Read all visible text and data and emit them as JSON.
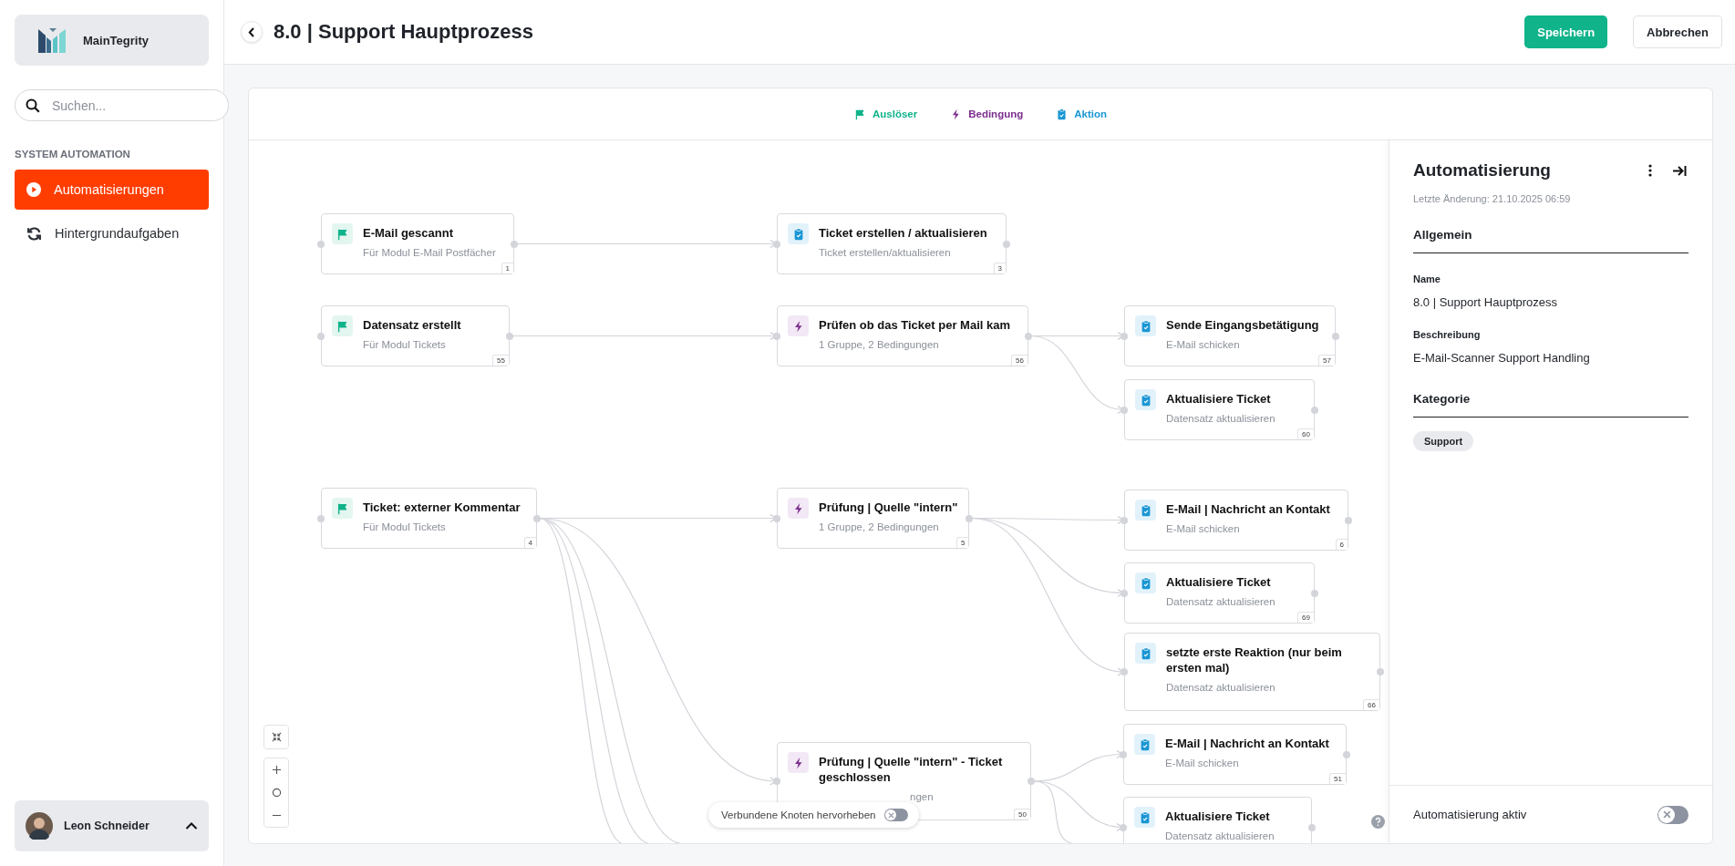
{
  "app": {
    "name": "MainTegrity"
  },
  "search": {
    "placeholder": "Suchen..."
  },
  "sidebar": {
    "section": "SYSTEM AUTOMATION",
    "items": [
      {
        "label": "Automatisierungen",
        "selected": true
      },
      {
        "label": "Hintergrundaufgaben",
        "selected": false
      }
    ]
  },
  "user": {
    "name": "Leon Schneider"
  },
  "header": {
    "title": "8.0 | Support Hauptprozess",
    "buttons": [
      {
        "label": "Speichern",
        "kind": "primary"
      },
      {
        "label": "Abbrechen",
        "kind": "secondary"
      }
    ]
  },
  "legend": [
    {
      "label": "Auslöser",
      "kind": "trigger"
    },
    {
      "label": "Bedingung",
      "kind": "condition"
    },
    {
      "label": "Aktion",
      "kind": "action"
    }
  ],
  "nodes": [
    {
      "kind": "trigger",
      "title": "E-Mail gescannt",
      "subtitle": "Für Modul E-Mail Postfächer",
      "number": "1"
    },
    {
      "kind": "action",
      "title": "Ticket erstellen / aktualisieren",
      "subtitle": "Ticket erstellen/aktualisieren",
      "number": "3"
    },
    {
      "kind": "trigger",
      "title": "Datensatz erstellt",
      "subtitle": "Für Modul Tickets",
      "number": "55"
    },
    {
      "kind": "condition",
      "title": "Prüfen ob das Ticket per Mail kam",
      "subtitle": "1 Gruppe, 2 Bedingungen",
      "number": "56"
    },
    {
      "kind": "action",
      "title": "Sende Eingangsbetätigung",
      "subtitle": "E-Mail schicken",
      "number": "57"
    },
    {
      "kind": "action",
      "title": "Aktualisiere Ticket",
      "subtitle": "Datensatz aktualisieren",
      "number": "60"
    },
    {
      "kind": "trigger",
      "title": "Ticket: externer Kommentar",
      "subtitle": "Für Modul Tickets",
      "number": "4"
    },
    {
      "kind": "condition",
      "title": "Prüfung | Quelle \"intern\"",
      "subtitle": "1 Gruppe, 2 Bedingungen",
      "number": "5"
    },
    {
      "kind": "action",
      "title": "E-Mail | Nachricht an Kontakt",
      "subtitle": "E-Mail schicken",
      "number": "6"
    },
    {
      "kind": "action",
      "title": "Aktualisiere Ticket",
      "subtitle": "Datensatz aktualisieren",
      "number": "69"
    },
    {
      "kind": "action",
      "title": "setzte erste Reaktion (nur beim ersten mal)",
      "subtitle": "Datensatz aktualisieren",
      "number": "66"
    },
    {
      "kind": "condition",
      "title": "Prüfung | Quelle \"intern\" - Ticket geschlossen",
      "subtitle": "ngen",
      "covered": true,
      "number": "50"
    },
    {
      "kind": "action",
      "title": "E-Mail | Nachricht an Kontakt",
      "subtitle": "E-Mail schicken",
      "number": "51"
    },
    {
      "kind": "action",
      "title": "Aktualisiere Ticket",
      "subtitle": "Datensatz aktualisieren"
    }
  ],
  "highlight_toggle": {
    "label": "Verbundene Knoten hervorheben",
    "on": false
  },
  "panel": {
    "title": "Automatisierung",
    "modified": "Letzte Änderung: 21.10.2025 06:59",
    "general": {
      "heading": "Allgemein",
      "fields": [
        {
          "label": "Name",
          "value": "8.0 | Support Hauptprozess"
        },
        {
          "label": "Beschreibung",
          "value": "E-Mail-Scanner Support Handling"
        }
      ]
    },
    "category": {
      "heading": "Kategorie",
      "tags": [
        "Support"
      ]
    },
    "active_toggle": {
      "label": "Automatisierung aktiv",
      "on": false
    }
  }
}
